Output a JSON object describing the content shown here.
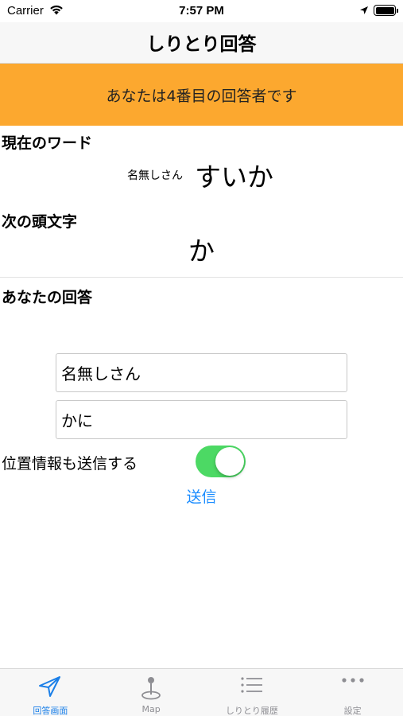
{
  "status_bar": {
    "carrier": "Carrier",
    "time": "7:57 PM"
  },
  "nav": {
    "title": "しりとり回答"
  },
  "banner": {
    "text": "あなたは4番目の回答者です",
    "color": "#fca82f"
  },
  "current_word": {
    "label": "現在のワード",
    "author": "名無しさん",
    "word": "すいか"
  },
  "next_char": {
    "label": "次の頭文字",
    "char": "か"
  },
  "answer": {
    "label": "あなたの回答",
    "name_value": "名無しさん",
    "answer_value": "かに"
  },
  "location": {
    "label": "位置情報も送信する",
    "enabled": true
  },
  "send_label": "送信",
  "tabs": [
    {
      "label": "回答画面",
      "icon": "paper-plane-icon",
      "active": true
    },
    {
      "label": "Map",
      "icon": "map-pin-icon",
      "active": false
    },
    {
      "label": "しりとり履歴",
      "icon": "list-icon",
      "active": false
    },
    {
      "label": "設定",
      "icon": "more-icon",
      "active": false
    }
  ],
  "colors": {
    "accent": "#1a7fe8",
    "toggle_on": "#4cd964",
    "inactive": "#8e8e93"
  }
}
